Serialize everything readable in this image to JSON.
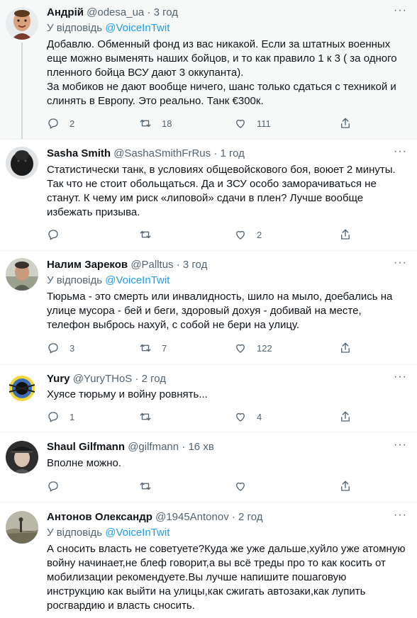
{
  "tweets": [
    {
      "name": "Андрій",
      "handle": "@odesa_ua",
      "dot": "·",
      "time": "3 год",
      "more": "···",
      "reply_prefix": "У відповідь",
      "reply_mention": "@VoiceInTwit",
      "lines": [
        "Добавлю. Обменный фонд из вас никакой. Если за штатных военных",
        "еще можно выменять наших бойцов, и то как правило 1 к 3 ( за одного",
        "пленного бойца ВСУ дают 3 оккупанта).",
        "За мобиков не дают вообще ничего, шанс только сдаться с техникой и",
        "слинять в Европу. Это реально. Танк €300к."
      ],
      "replies": "2",
      "retweets": "18",
      "likes": "111"
    },
    {
      "name": "Sasha Smith",
      "handle": "@SashaSmithFrRus",
      "dot": "·",
      "time": "1 год",
      "more": "···",
      "lines": [
        "Статистически танк, в условиях общевойскового боя, воюет 2 минуты.",
        "Так что не стоит обольщаться. Да и ЗСУ особо заморачиваться не",
        "станут. К чему им риск «липовой» сдачи в плен? Лучше вообще",
        "избежать призыва."
      ],
      "replies": "",
      "retweets": "",
      "likes": "2"
    },
    {
      "name": "Налим Зареков",
      "handle": "@Palltus",
      "dot": "·",
      "time": "3 год",
      "more": "···",
      "reply_prefix": "У відповідь",
      "reply_mention": "@VoiceInTwit",
      "lines": [
        "Тюрьма - это смерть или инвалидность, шило на мыло, доебались на",
        "улице мусора - бей и беги, здоровый дохуя - добивай на месте,",
        "телефон выбрось нахуй, с собой не бери на улицу."
      ],
      "replies": "3",
      "retweets": "7",
      "likes": "122"
    },
    {
      "name": "Yury",
      "handle": "@YuryTHoS",
      "dot": "·",
      "time": "2 год",
      "more": "···",
      "lines": [
        "Хуясе тюрьму и войну ровнять..."
      ],
      "replies": "1",
      "retweets": "",
      "likes": "4"
    },
    {
      "name": "Shaul Gilfmann",
      "handle": "@gilfmann",
      "dot": "·",
      "time": "16 хв",
      "more": "···",
      "lines": [
        "Вполне можно."
      ],
      "replies": "",
      "retweets": "",
      "likes": ""
    },
    {
      "name": "Антонов Олександр",
      "handle": "@1945Antonov",
      "dot": "·",
      "time": "2 год",
      "more": "···",
      "reply_prefix": "У відповідь",
      "reply_mention": "@VoiceInTwit",
      "lines": [
        "А сносить власть не советуете?Куда же уже дальше,хуйло уже атомную",
        "войну начинает,не блеф говорит,а вы всё треды про то как косить от",
        "мобилизации рекомендуете.Вы лучше напишите пошаговую",
        "инструкцию как выйти на улицы,как сжигать автозаки,как лупить",
        "росгвардию и власть сносить."
      ]
    }
  ],
  "colors": {
    "accent": "#1d9bf0",
    "secondary_text": "#536471",
    "highlight_bg": "#f7f9f9",
    "thread_line": "#cfd9de"
  },
  "icons": [
    "reply-icon",
    "retweet-icon",
    "like-icon",
    "share-icon",
    "more-icon"
  ]
}
